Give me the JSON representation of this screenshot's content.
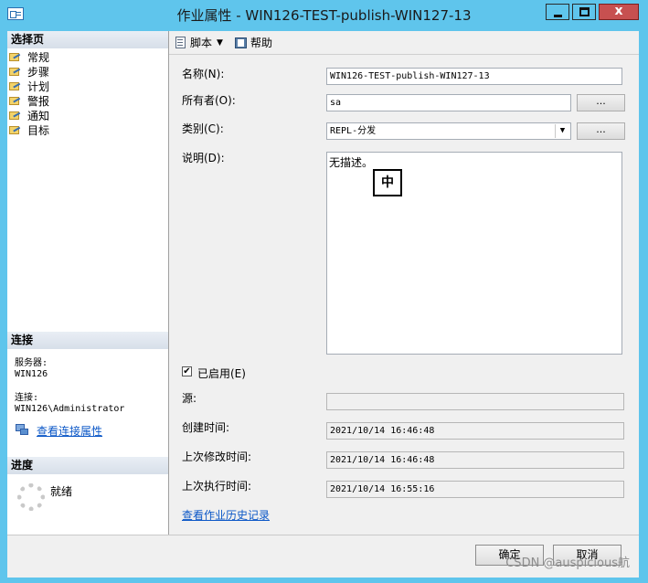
{
  "window": {
    "title": "作业属性 - WIN126-TEST-publish-WIN127-13",
    "close_glyph": "x"
  },
  "sidebar": {
    "header": "选择页",
    "items": [
      {
        "label": "常规"
      },
      {
        "label": "步骤"
      },
      {
        "label": "计划"
      },
      {
        "label": "警报"
      },
      {
        "label": "通知"
      },
      {
        "label": "目标"
      }
    ]
  },
  "connection": {
    "header": "连接",
    "server_label": "服务器:",
    "server": "WIN126",
    "conn_label": "连接:",
    "conn": "WIN126\\Administrator",
    "link": "查看连接属性"
  },
  "progress": {
    "header": "进度",
    "status": "就绪"
  },
  "toolbar": {
    "script_label": "脚本",
    "help_label": "帮助"
  },
  "form": {
    "name_label": "名称(N):",
    "name_value": "WIN126-TEST-publish-WIN127-13",
    "owner_label": "所有者(O):",
    "owner_value": "sa",
    "category_label": "类别(C):",
    "category_value": "REPL-分发",
    "desc_label": "说明(D):",
    "desc_value": "无描述。",
    "ime_indicator": "中",
    "browse_label": "...",
    "enabled_label": "已启用(E)",
    "enabled_checked": true,
    "enabled_check_glyph": "✔",
    "source_label": "源:",
    "source_value": "",
    "created_label": "创建时间:",
    "created_value": "2021/10/14 16:46:48",
    "modified_label": "上次修改时间:",
    "modified_value": "2021/10/14 16:46:48",
    "executed_label": "上次执行时间:",
    "executed_value": "2021/10/14 16:55:16",
    "history_link": "查看作业历史记录"
  },
  "buttons": {
    "ok": "确定",
    "cancel": "取消"
  },
  "watermark": "CSDN @auspicious航"
}
